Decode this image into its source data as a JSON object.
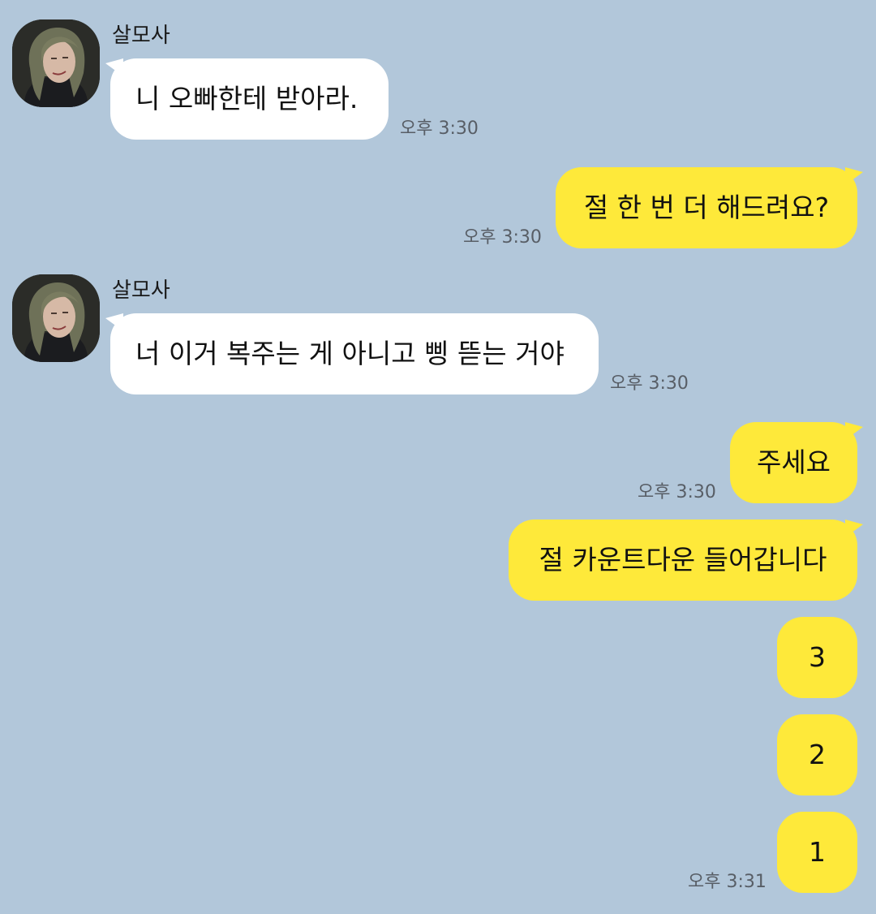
{
  "messages": [
    {
      "sender": "살모사",
      "text": "니 오빠한테 받아라.",
      "time": "오후 3:30"
    },
    {
      "text": "절 한 번 더 해드려요?",
      "time": "오후 3:30"
    },
    {
      "sender": "살모사",
      "text": "너 이거 복주는 게 아니고 삥 뜯는 거야",
      "time": "오후 3:30"
    },
    {
      "text": "주세요",
      "time": "오후 3:30"
    },
    {
      "text": "절 카운트다운 들어갑니다"
    },
    {
      "text": "3"
    },
    {
      "text": "2"
    },
    {
      "text": "1",
      "time": "오후 3:31"
    }
  ],
  "colors": {
    "background": "#b2c7da",
    "incoming_bubble": "#ffffff",
    "outgoing_bubble": "#fee93a",
    "time_text": "#585e66"
  }
}
